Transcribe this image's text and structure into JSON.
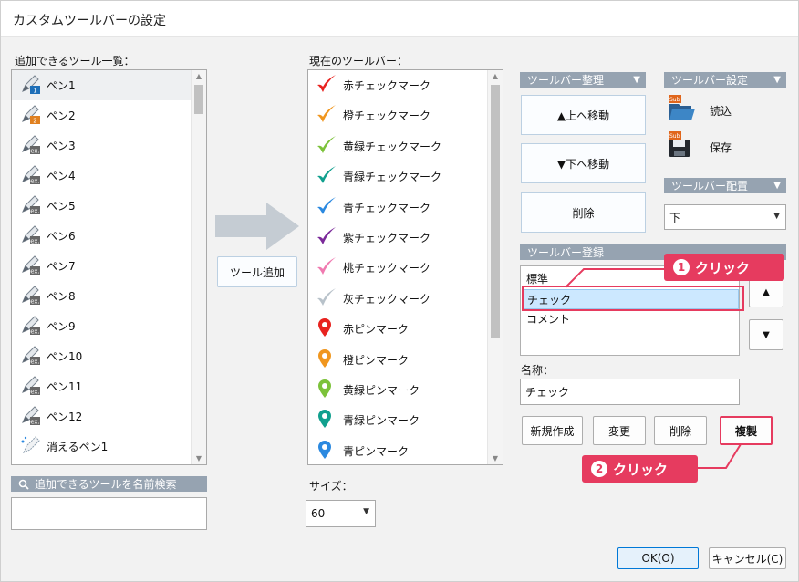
{
  "window": {
    "title": "カスタムツールバーの設定"
  },
  "available_tools": {
    "label": "追加できるツール一覧：",
    "items": [
      {
        "label": "ペン1",
        "badge": "1",
        "badge_color": "#1e6fb8"
      },
      {
        "label": "ペン2",
        "badge": "2",
        "badge_color": "#e08020"
      },
      {
        "label": "ペン3",
        "badge": "ex.",
        "badge_color": "#666666"
      },
      {
        "label": "ペン4",
        "badge": "ex.",
        "badge_color": "#666666"
      },
      {
        "label": "ペン5",
        "badge": "ex.",
        "badge_color": "#666666"
      },
      {
        "label": "ペン6",
        "badge": "ex.",
        "badge_color": "#666666"
      },
      {
        "label": "ペン7",
        "badge": "ex.",
        "badge_color": "#666666"
      },
      {
        "label": "ペン8",
        "badge": "ex.",
        "badge_color": "#666666"
      },
      {
        "label": "ペン9",
        "badge": "ex.",
        "badge_color": "#666666"
      },
      {
        "label": "ペン10",
        "badge": "ex.",
        "badge_color": "#666666"
      },
      {
        "label": "ペン11",
        "badge": "ex.",
        "badge_color": "#666666"
      },
      {
        "label": "ペン12",
        "badge": "ex.",
        "badge_color": "#666666"
      },
      {
        "label": "消えるペン1",
        "badge": "",
        "badge_color": "#1e6fb8"
      }
    ],
    "search_label": "追加できるツールを名前検索",
    "search_value": ""
  },
  "add_button": {
    "label": "ツール追加"
  },
  "current_toolbar": {
    "label": "現在のツールバー：",
    "items": [
      {
        "label": "赤チェックマーク",
        "kind": "check",
        "color": "#e8231f"
      },
      {
        "label": "橙チェックマーク",
        "kind": "check",
        "color": "#f0961e"
      },
      {
        "label": "黄緑チェックマーク",
        "kind": "check",
        "color": "#7cc23a"
      },
      {
        "label": "青緑チェックマーク",
        "kind": "check",
        "color": "#11a08e"
      },
      {
        "label": "青チェックマーク",
        "kind": "check",
        "color": "#2b89e0"
      },
      {
        "label": "紫チェックマーク",
        "kind": "check",
        "color": "#7b2a9a"
      },
      {
        "label": "桃チェックマーク",
        "kind": "check",
        "color": "#f07ab0"
      },
      {
        "label": "灰チェックマーク",
        "kind": "check",
        "color": "#b8c2ca"
      },
      {
        "label": "赤ピンマーク",
        "kind": "pin",
        "color": "#e8231f"
      },
      {
        "label": "橙ピンマーク",
        "kind": "pin",
        "color": "#f0961e"
      },
      {
        "label": "黄緑ピンマーク",
        "kind": "pin",
        "color": "#7cc23a"
      },
      {
        "label": "青緑ピンマーク",
        "kind": "pin",
        "color": "#11a08e"
      },
      {
        "label": "青ピンマーク",
        "kind": "pin",
        "color": "#2b89e0"
      }
    ],
    "size_label": "サイズ：",
    "size_value": "60"
  },
  "organize": {
    "header": "ツールバー整理",
    "move_up": "▲上へ移動",
    "move_down": "▼下へ移動",
    "delete": "削除"
  },
  "settings": {
    "header": "ツールバー設定",
    "load": "読込",
    "save": "保存",
    "placement_header": "ツールバー配置",
    "placement_value": "下"
  },
  "register": {
    "header": "ツールバー登録",
    "items": [
      "標準",
      "チェック",
      "コメント"
    ],
    "selected_index": 1,
    "up_arrow": "▲",
    "down_arrow": "▼",
    "name_label": "名称：",
    "name_value": "チェック",
    "new_button": "新規作成",
    "change_button": "変更",
    "delete_button": "削除",
    "duplicate_button": "複製"
  },
  "annotations": [
    {
      "number": "1",
      "text": "クリック"
    },
    {
      "number": "2",
      "text": "クリック"
    }
  ],
  "footer": {
    "ok": "OK(O)",
    "cancel": "キャンセル(C)"
  },
  "colors": {
    "accent": "#e63b5f",
    "header_bar": "#96a3b1",
    "selection": "#cce8ff"
  }
}
